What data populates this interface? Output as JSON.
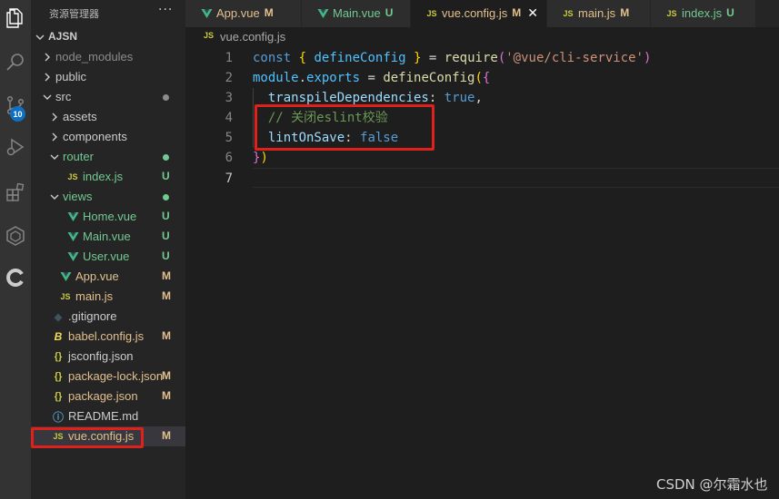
{
  "explorer": {
    "title": "资源管理器",
    "more_label": "···",
    "tree": [
      {
        "label": "AJSN",
        "indent": 0,
        "chevron": "down",
        "bold": true
      },
      {
        "label": "node_modules",
        "indent": 1,
        "chevron": "right",
        "color": "dim"
      },
      {
        "label": "public",
        "indent": 1,
        "chevron": "right"
      },
      {
        "label": "src",
        "indent": 1,
        "chevron": "down",
        "dot": "#8c8c8c"
      },
      {
        "label": "assets",
        "indent": 2,
        "chevron": "right"
      },
      {
        "label": "components",
        "indent": 2,
        "chevron": "right"
      },
      {
        "label": "router",
        "indent": 2,
        "chevron": "down",
        "color": "unt",
        "dot": "#73c991"
      },
      {
        "label": "index.js",
        "indent": 3,
        "icon": "js",
        "color": "unt",
        "status": "U"
      },
      {
        "label": "views",
        "indent": 2,
        "chevron": "down",
        "color": "unt",
        "dot": "#73c991"
      },
      {
        "label": "Home.vue",
        "indent": 3,
        "icon": "vue",
        "color": "unt",
        "status": "U"
      },
      {
        "label": "Main.vue",
        "indent": 3,
        "icon": "vue",
        "color": "unt",
        "status": "U"
      },
      {
        "label": "User.vue",
        "indent": 3,
        "icon": "vue",
        "color": "unt",
        "status": "U"
      },
      {
        "label": "App.vue",
        "indent": 2,
        "icon": "vue",
        "color": "mod",
        "status": "M"
      },
      {
        "label": "main.js",
        "indent": 2,
        "icon": "js",
        "color": "mod",
        "status": "M"
      },
      {
        "label": ".gitignore",
        "indent": 1,
        "icon": "git"
      },
      {
        "label": "babel.config.js",
        "indent": 1,
        "icon": "babel",
        "color": "mod",
        "status": "M"
      },
      {
        "label": "jsconfig.json",
        "indent": 1,
        "icon": "json"
      },
      {
        "label": "package-lock.json",
        "indent": 1,
        "icon": "json",
        "color": "mod",
        "status": "M"
      },
      {
        "label": "package.json",
        "indent": 1,
        "icon": "json",
        "color": "mod",
        "status": "M"
      },
      {
        "label": "README.md",
        "indent": 1,
        "icon": "info"
      },
      {
        "label": "vue.config.js",
        "indent": 1,
        "icon": "js",
        "color": "mod",
        "status": "M",
        "selected": true
      }
    ]
  },
  "activity": {
    "icons": [
      "files-icon",
      "search-icon",
      "source-control-icon",
      "run-debug-icon",
      "extensions-icon",
      "remote-icon",
      "accounts-icon"
    ],
    "scm_badge": "10"
  },
  "tabs": [
    {
      "label": "App.vue",
      "icon": "vue",
      "status": "M",
      "color": "mod"
    },
    {
      "label": "Main.vue",
      "icon": "vue",
      "status": "U",
      "color": "unt"
    },
    {
      "label": "vue.config.js",
      "icon": "js",
      "status": "M",
      "color": "mod",
      "active": true,
      "close": "✕"
    },
    {
      "label": "main.js",
      "icon": "js",
      "status": "M",
      "color": "mod"
    },
    {
      "label": "index.js",
      "icon": "js",
      "status": "U",
      "color": "unt"
    }
  ],
  "breadcrumb": {
    "icon": "JS",
    "file": "vue.config.js"
  },
  "code": {
    "current_line": 7,
    "lines": [
      {
        "n": "1",
        "tokens": [
          [
            "k-blue",
            "const"
          ],
          [
            "k-pl",
            " "
          ],
          [
            "k-b1",
            "{"
          ],
          [
            "k-pl",
            " "
          ],
          [
            "k-var",
            "defineConfig"
          ],
          [
            "k-pl",
            " "
          ],
          [
            "k-b1",
            "}"
          ],
          [
            "k-pl",
            " = "
          ],
          [
            "k-fn",
            "require"
          ],
          [
            "k-b2",
            "("
          ],
          [
            "k-str",
            "'@vue/cli-service'"
          ],
          [
            "k-b2",
            ")"
          ]
        ]
      },
      {
        "n": "2",
        "tokens": [
          [
            "k-var",
            "module"
          ],
          [
            "k-pl",
            "."
          ],
          [
            "k-var",
            "exports"
          ],
          [
            "k-pl",
            " = "
          ],
          [
            "k-fn",
            "defineConfig"
          ],
          [
            "k-b1",
            "("
          ],
          [
            "k-b2",
            "{"
          ]
        ]
      },
      {
        "n": "3",
        "tokens": [
          [
            "k-pl",
            "  "
          ],
          [
            "k-prop",
            "transpileDependencies"
          ],
          [
            "k-pl",
            ": "
          ],
          [
            "k-blue",
            "true"
          ],
          [
            "k-pl",
            ","
          ]
        ]
      },
      {
        "n": "4",
        "tokens": [
          [
            "k-pl",
            "  "
          ],
          [
            "k-com",
            "// 关闭eslint校验"
          ]
        ]
      },
      {
        "n": "5",
        "tokens": [
          [
            "k-pl",
            "  "
          ],
          [
            "k-prop",
            "lintOnSave"
          ],
          [
            "k-pl",
            ": "
          ],
          [
            "k-blue",
            "false"
          ]
        ]
      },
      {
        "n": "6",
        "tokens": [
          [
            "k-b2",
            "}"
          ],
          [
            "k-b1",
            ")"
          ]
        ]
      },
      {
        "n": "7",
        "tokens": []
      }
    ]
  },
  "colors": {
    "highlight": "#e0201a",
    "modified": "#e2c08d",
    "untracked": "#73c991",
    "js_icon": "#cbcb41",
    "vue_icon": "#41b883"
  },
  "watermark": "CSDN @尔霜水也"
}
